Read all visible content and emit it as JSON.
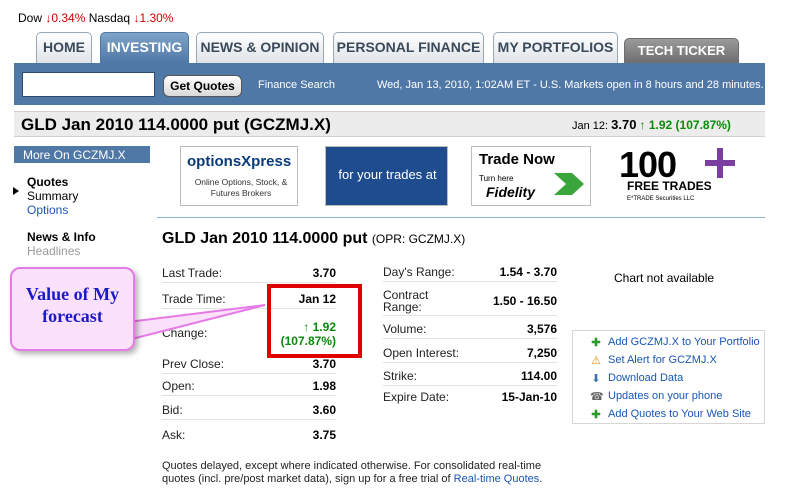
{
  "ticker": {
    "dow_label": "Dow",
    "dow_change": "0.34%",
    "nasdaq_label": "Nasdaq",
    "nasdaq_change": "1.30%",
    "down_arrow": "↓"
  },
  "tabs": [
    {
      "label": "HOME"
    },
    {
      "label": "INVESTING"
    },
    {
      "label": "NEWS & OPINION"
    },
    {
      "label": "PERSONAL FINANCE"
    },
    {
      "label": "MY PORTFOLIOS"
    },
    {
      "label": "TECH TICKER"
    }
  ],
  "searchbar": {
    "input_value": "",
    "button_label": "Get Quotes",
    "finance_search_label": "Finance Search",
    "datetime": "Wed, Jan 13, 2010, 1:02AM ET - U.S. Markets open in 8 hours and 28 minutes."
  },
  "header": {
    "title": "GLD Jan 2010 114.0000 put (GCZMJ.X)",
    "date_label": "Jan 12:",
    "price": "3.70",
    "change": "↑ 1.92 (107.87%)"
  },
  "leftnav": {
    "header": "More On GCZMJ.X",
    "quotes": "Quotes",
    "summary": "Summary",
    "options": "Options",
    "news": "News & Info",
    "headlines": "Headlines"
  },
  "ads": {
    "ad1_title": "optionsXpress",
    "ad1_sub": "Online Options, Stock, & Futures Brokers",
    "ad2_text": "for your trades at",
    "ad3_title": "Trade Now",
    "ad3_sub": "Turn here",
    "ad3_brand": "Fidelity",
    "ad4_number": "100",
    "ad4_text": "FREE TRADES",
    "ad4_small": "E*TRADE Securities LLC"
  },
  "quote": {
    "title": "GLD Jan 2010 114.0000 put",
    "subtitle": "(OPR: GCZMJ.X)",
    "left_rows": [
      {
        "label": "Last Trade:",
        "value": "3.70"
      },
      {
        "label": "Trade Time:",
        "value": "Jan 12"
      },
      {
        "label": "Change:",
        "value": ""
      },
      {
        "label": "Prev Close:",
        "value": "3.70"
      },
      {
        "label": "Open:",
        "value": "1.98"
      },
      {
        "label": "Bid:",
        "value": "3.60"
      },
      {
        "label": "Ask:",
        "value": "3.75"
      }
    ],
    "change_line1": "↑ 1.92",
    "change_line2": "(107.87%)",
    "right_rows": [
      {
        "label": "Day's Range:",
        "value": "1.54 - 3.70"
      },
      {
        "label": "Contract Range:",
        "value": "1.50 - 16.50"
      },
      {
        "label": "Volume:",
        "value": "3,576"
      },
      {
        "label": "Open Interest:",
        "value": "7,250"
      },
      {
        "label": "Strike:",
        "value": "114.00"
      },
      {
        "label": "Expire Date:",
        "value": "15-Jan-10"
      }
    ]
  },
  "annotation": {
    "text": "Value of My forecast",
    "box_color": "#e00000"
  },
  "chart_panel": {
    "message": "Chart not available"
  },
  "actions": [
    {
      "label": "Add GCZMJ.X to Your Portfolio",
      "icon": "plus-icon"
    },
    {
      "label": "Set Alert for GCZMJ.X",
      "icon": "alert-icon"
    },
    {
      "label": "Download Data",
      "icon": "download-icon"
    },
    {
      "label": "Updates on your phone",
      "icon": "phone-icon"
    },
    {
      "label": "Add Quotes to Your Web Site",
      "icon": "plus-icon"
    }
  ],
  "footer": {
    "text": "Quotes delayed, except where indicated otherwise. For consolidated real-time quotes (incl. pre/post market data), sign up for a free trial of",
    "link": "Real-time Quotes",
    "end": "."
  }
}
